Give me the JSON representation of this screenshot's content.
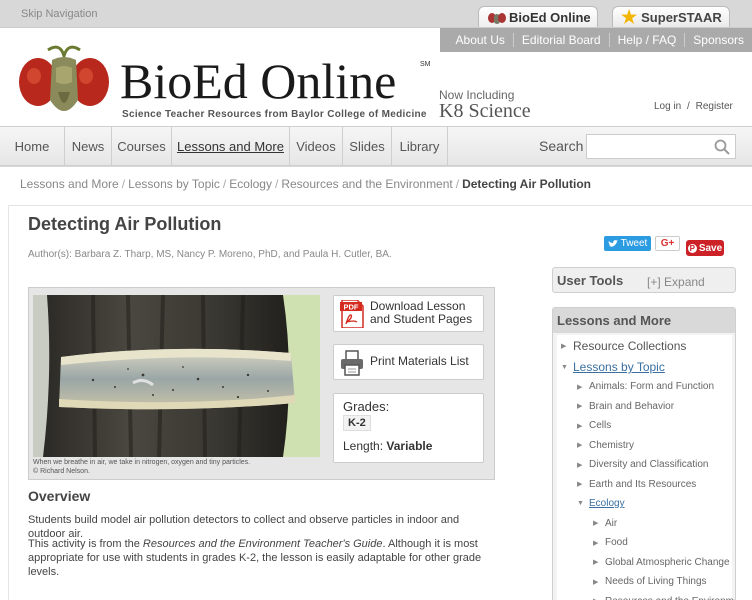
{
  "top": {
    "skip": "Skip Navigation",
    "tab_bioed": "BioEd Online",
    "tab_staar": "SuperSTAAR"
  },
  "utility_nav": [
    "About Us",
    "Editorial Board",
    "Help / FAQ",
    "Sponsors"
  ],
  "logo": {
    "title": "BioEd Online",
    "sm": "SM",
    "tagline": "Science Teacher Resources from Baylor College of Medicine",
    "now_including": "Now Including",
    "k8": "K8 Science"
  },
  "auth": {
    "login": "Log in",
    "sep": "/",
    "register": "Register"
  },
  "nav": {
    "items": [
      "Home",
      "News",
      "Courses",
      "Lessons and More",
      "Videos",
      "Slides",
      "Library"
    ],
    "active": "Lessons and More",
    "search_label": "Search",
    "search_value": ""
  },
  "breadcrumb": [
    "Lessons and More",
    "Lessons by Topic",
    "Ecology",
    "Resources and the Environment"
  ],
  "breadcrumb_current": "Detecting Air Pollution",
  "page": {
    "title": "Detecting Air Pollution",
    "authors": "Author(s): Barbara Z. Tharp, MS, Nancy P. Moreno, PhD, and Paula H. Cutler, BA."
  },
  "share": {
    "tweet": "Tweet",
    "gplus": "G+",
    "save": "Save"
  },
  "lesson": {
    "caption_line1": "When we breathe in air, we take in nitrogen, oxygen and tiny particles.",
    "caption_line2": "© Richard Nelson.",
    "download_line1": "Download Lesson",
    "download_line2": "and Student Pages",
    "pdf_icon_text": "PDF",
    "print": "Print Materials List",
    "grades_label": "Grades:",
    "grade_value": "K-2",
    "length_label": "Length:",
    "length_value": "Variable"
  },
  "overview": {
    "title": "Overview",
    "p1": "Students build model air pollution detectors to collect and observe particles in indoor and outdoor air.",
    "p2_a": "This activity is from the ",
    "p2_i": "Resources and the Environment Teacher's Guide",
    "p2_b": ". Although it is most appropriate for use with students in grades K-2, the lesson is easily adaptable for other grade levels."
  },
  "sidebar": {
    "user_tools": "User Tools",
    "expand": "[+] Expand",
    "lam_title": "Lessons and More",
    "tree": [
      {
        "label": "Resource Collections",
        "level": 0,
        "arrow": "right"
      },
      {
        "label": "Lessons by Topic",
        "level": 0,
        "arrow": "down"
      },
      {
        "label": "Animals: Form and Function",
        "level": 1,
        "arrow": "right"
      },
      {
        "label": "Brain and Behavior",
        "level": 1,
        "arrow": "right"
      },
      {
        "label": "Cells",
        "level": 1,
        "arrow": "right"
      },
      {
        "label": "Chemistry",
        "level": 1,
        "arrow": "right"
      },
      {
        "label": "Diversity and Classification",
        "level": 1,
        "arrow": "right"
      },
      {
        "label": "Earth and Its Resources",
        "level": 1,
        "arrow": "right"
      },
      {
        "label": "Ecology",
        "level": 1,
        "arrow": "down"
      },
      {
        "label": "Air",
        "level": 2,
        "arrow": "right"
      },
      {
        "label": "Food",
        "level": 2,
        "arrow": "right"
      },
      {
        "label": "Global Atmospheric Change",
        "level": 2,
        "arrow": "right"
      },
      {
        "label": "Needs of Living Things",
        "level": 2,
        "arrow": "right"
      },
      {
        "label": "Resources and the Environment",
        "level": 2,
        "arrow": "right"
      }
    ]
  },
  "colors": {
    "accent_blue": "#3a6fa0",
    "tweet": "#2b9be2",
    "save": "#cc2127",
    "pdf": "#d42a20"
  }
}
